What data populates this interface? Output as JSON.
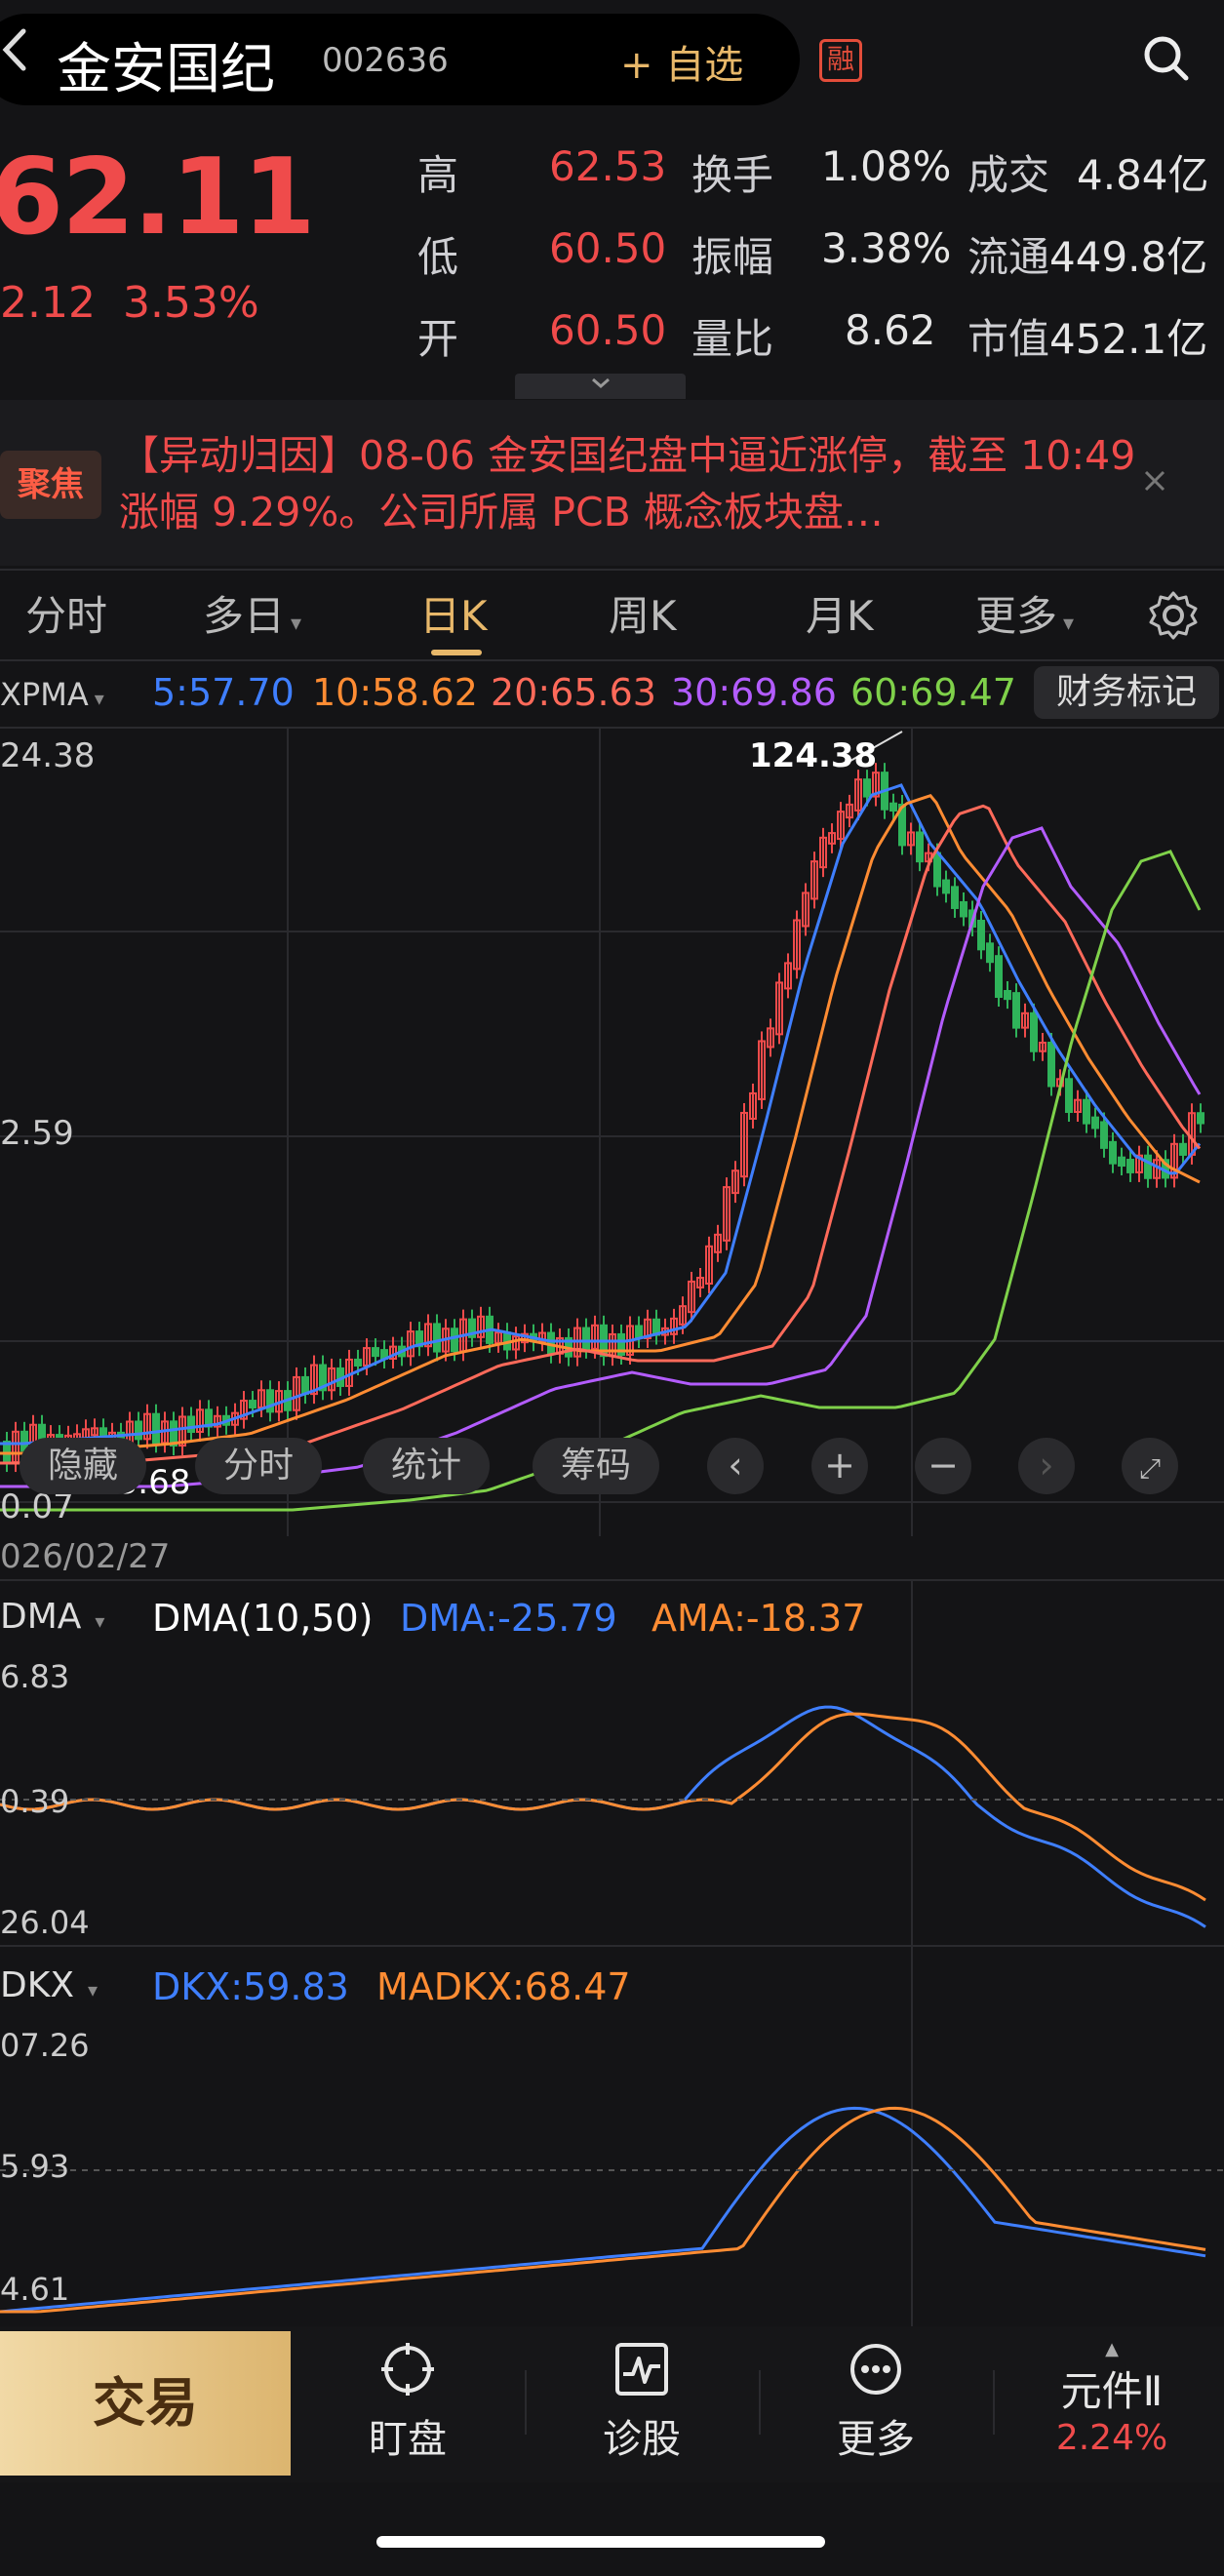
{
  "header": {
    "back_icon": "chevron-left-icon",
    "stock_name": "金安国纪",
    "stock_code": "002636",
    "add_watchlist": "+ 自选",
    "margin_badge": "融",
    "search_icon": "search-icon"
  },
  "quote": {
    "price": "62.11",
    "change": "2.12",
    "change_pct": "3.53%",
    "rows": [
      {
        "l1": "高",
        "v1": "62.53",
        "l2": "换手",
        "v2": "1.08%",
        "l3": "成交",
        "v3": "4.84亿"
      },
      {
        "l1": "低",
        "v1": "60.50",
        "l2": "振幅",
        "v2": "3.38%",
        "l3": "流通",
        "v3": "449.8亿"
      },
      {
        "l1": "开",
        "v1": "60.50",
        "l2": "量比",
        "v2": "8.62",
        "l3": "市值",
        "v3": "452.1亿"
      }
    ],
    "expand_icon": "chevron-down-icon"
  },
  "news": {
    "badge": "聚焦",
    "text": "【异动归因】08-06 金安国纪盘中逼近涨停，截至 10:49 涨幅 9.29%。公司所属 PCB 概念板块盘…",
    "close_icon": "close-icon"
  },
  "tabs": {
    "items": [
      "分时",
      "多日",
      "日K",
      "周K",
      "月K",
      "更多"
    ],
    "dropdown_marks": [
      "",
      "▾",
      "",
      "",
      "",
      "▾"
    ],
    "active": "日K",
    "settings_icon": "gear-icon"
  },
  "main_indicator": {
    "name": "XPMA",
    "values": [
      {
        "label": "5:57.70",
        "color": "#3f7fff"
      },
      {
        "label": "10:58.62",
        "color": "#ff8c33"
      },
      {
        "label": "20:65.63",
        "color": "#ff6a5a"
      },
      {
        "label": "30:69.86",
        "color": "#b35cff"
      },
      {
        "label": "60:69.47",
        "color": "#7fd14a"
      }
    ],
    "finance_marks_btn": "财务标记",
    "axis": {
      "top": "24.38",
      "mid": "2.59",
      "low": "0.07"
    },
    "max_label": "124.38",
    "min_label": "23.68",
    "date_left": "026/02/27"
  },
  "chart_controls": {
    "hide": "隐藏",
    "intraday": "分时",
    "stats": "统计",
    "chips": "筹码",
    "prev_icon": "chevron-left-icon",
    "zoom_in_icon": "plus-icon",
    "zoom_out_icon": "minus-icon",
    "next_icon": "chevron-right-icon",
    "fullscreen_icon": "fullscreen-icon"
  },
  "dma": {
    "name": "DMA",
    "params": "DMA(10,50)",
    "dma_label": "DMA:-25.79",
    "ama_label": "AMA:-18.37",
    "axis": {
      "top": "6.83",
      "mid": "0.39",
      "low": "26.04"
    }
  },
  "dkx": {
    "name": "DKX",
    "dkx_label": "DKX:59.83",
    "madkx_label": "MADKX:68.47",
    "axis": {
      "top": "07.26",
      "mid": "5.93",
      "low": "4.61"
    }
  },
  "colors": {
    "up": "#ef4b4b",
    "down": "#2fb35a",
    "accent": "#e8b86a",
    "background": "#141416"
  },
  "bottom_bar": {
    "trade": "交易",
    "watch": "盯盘",
    "watch_icon": "crosshair-icon",
    "diagnose": "诊股",
    "diagnose_icon": "pulse-chart-icon",
    "more": "更多",
    "more_icon": "more-dots-icon",
    "sector_name": "元件Ⅱ",
    "sector_change": "2.24%"
  }
}
